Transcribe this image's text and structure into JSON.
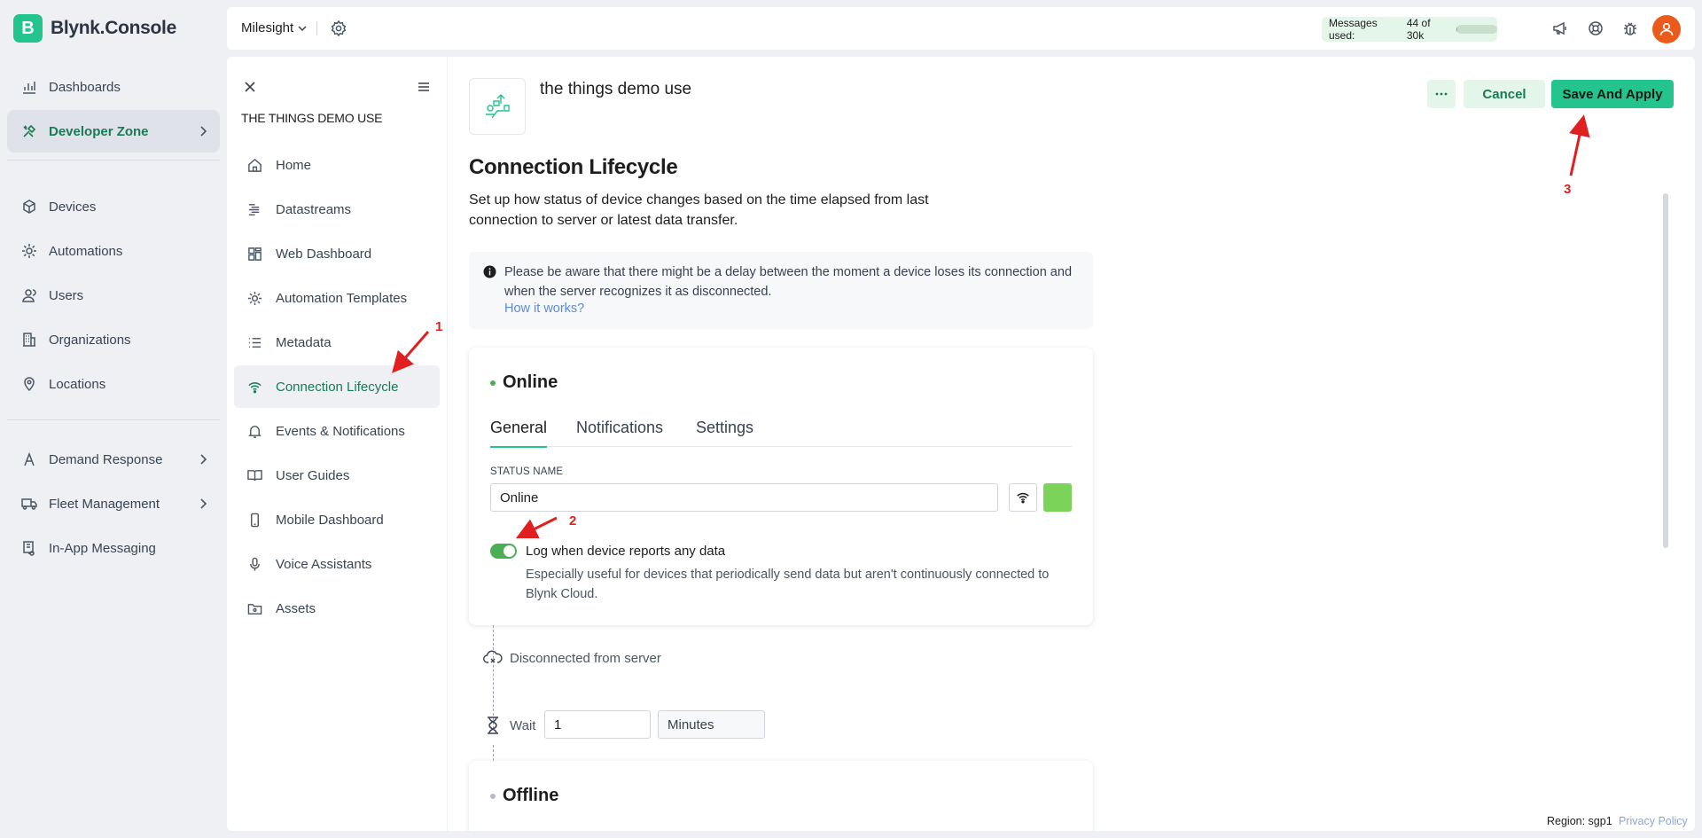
{
  "brand": {
    "logo_letter": "B",
    "name": "Blynk.Console",
    "accent": "#23c48e"
  },
  "left_nav": {
    "items": [
      {
        "label": "Dashboards",
        "icon": "chart-bars-icon"
      },
      {
        "label": "Developer Zone",
        "icon": "tools-icon",
        "active": true
      },
      {
        "label": "Devices",
        "icon": "cube-icon"
      },
      {
        "label": "Automations",
        "icon": "sun-gear-icon"
      },
      {
        "label": "Users",
        "icon": "users-icon"
      },
      {
        "label": "Organizations",
        "icon": "building-icon"
      },
      {
        "label": "Locations",
        "icon": "map-pin-icon"
      },
      {
        "label": "Demand Response",
        "icon": "compass-icon"
      },
      {
        "label": "Fleet Management",
        "icon": "truck-icon"
      },
      {
        "label": "In-App Messaging",
        "icon": "message-icon"
      }
    ]
  },
  "topbar": {
    "org_name": "Milesight",
    "messages_label": "Messages used:",
    "messages_value": "44 of 30k",
    "messages_fraction": 0.0015
  },
  "subnav": {
    "title": "THE THINGS DEMO USE",
    "items": [
      {
        "label": "Home",
        "icon": "home-icon"
      },
      {
        "label": "Datastreams",
        "icon": "datastreams-icon"
      },
      {
        "label": "Web Dashboard",
        "icon": "web-dashboard-icon"
      },
      {
        "label": "Automation Templates",
        "icon": "automation-icon"
      },
      {
        "label": "Metadata",
        "icon": "list-icon"
      },
      {
        "label": "Connection Lifecycle",
        "icon": "wifi-icon",
        "active": true
      },
      {
        "label": "Events & Notifications",
        "icon": "bell-icon"
      },
      {
        "label": "User Guides",
        "icon": "book-icon"
      },
      {
        "label": "Mobile Dashboard",
        "icon": "phone-icon"
      },
      {
        "label": "Voice Assistants",
        "icon": "microphone-icon"
      },
      {
        "label": "Assets",
        "icon": "folder-icon"
      }
    ]
  },
  "main": {
    "template_name": "the things demo use",
    "cancel_label": "Cancel",
    "save_label": "Save And Apply",
    "title": "Connection Lifecycle",
    "description": "Set up how status of device changes based on the time elapsed from last connection to server or latest data transfer.",
    "notice_text": "Please be aware that there might be a delay between the moment a device loses its connection and when the server recognizes it as disconnected.",
    "notice_link": "How it works?",
    "online": {
      "title": "Online",
      "dot_color": "#4cae54",
      "tabs": [
        "General",
        "Notifications",
        "Settings"
      ],
      "status_label": "STATUS NAME",
      "status_value": "Online",
      "status_color": "#7cd35a",
      "toggle_label": "Log when device reports any data",
      "toggle_on": true,
      "toggle_hint": "Especially useful for devices that periodically send data but aren't continuously connected to Blynk Cloud."
    },
    "disconnected_label": "Disconnected from server",
    "wait_label": "Wait",
    "wait_value": "1",
    "wait_unit": "Minutes",
    "offline": {
      "title": "Offline",
      "dot_color": "#b8bcc3"
    }
  },
  "annotations": [
    "1",
    "2",
    "3"
  ],
  "footer": {
    "region": "Region: sgp1",
    "privacy": "Privacy Policy"
  }
}
